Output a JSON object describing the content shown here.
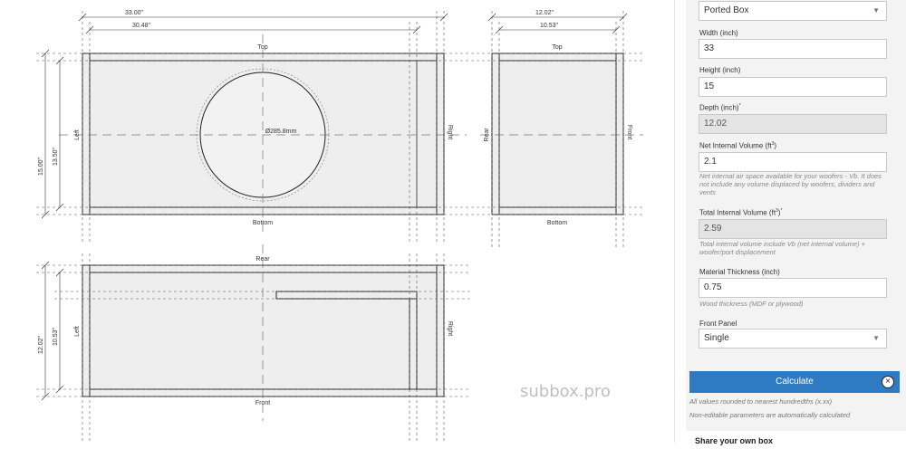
{
  "drawing": {
    "front_view": {
      "width_outer": "33.00\"",
      "width_inner": "30.48\"",
      "top": "Top",
      "bottom": "Bottom",
      "left": "Left",
      "right": "Right",
      "height_outer": "15.00\"",
      "height_inner": "13.50\"",
      "cutout": "Ø285.8mm"
    },
    "side_view": {
      "depth_outer": "12.02\"",
      "depth_inner": "10.53\"",
      "top": "Top",
      "bottom": "Bottom",
      "rear": "Rear",
      "front": "Front"
    },
    "top_view": {
      "rear": "Rear",
      "front": "Front",
      "left": "Left",
      "right": "Right",
      "depth_outer": "12.02\"",
      "depth_inner": "10.53\""
    },
    "watermark": "subbox.pro"
  },
  "panel": {
    "box_type": {
      "value": "Ported Box"
    },
    "width": {
      "label": "Width (inch)",
      "value": "33"
    },
    "height": {
      "label": "Height (inch)",
      "value": "15"
    },
    "depth": {
      "label": "Depth (inch)",
      "sup": "*",
      "value": "12.02"
    },
    "net_volume": {
      "label": "Net Internal Volume (ft",
      "sup": "3",
      "label_end": ")",
      "value": "2.1",
      "help": "Net internal air space available for your woofers - Vb. It does not include any volume displaced by woofers, dividers and vents"
    },
    "total_volume": {
      "label": "Total Internal Volume (ft",
      "sup": "3",
      "label_end": ")",
      "sup2": "*",
      "value": "2.59",
      "help": "Total internal volume include Vb (net internal volume) + woofer/port displacement"
    },
    "thickness": {
      "label": "Material Thickness (inch)",
      "value": "0.75",
      "help": "Wood thickness (MDF or plywood)"
    },
    "front_panel": {
      "label": "Front Panel",
      "value": "Single"
    },
    "calculate_label": "Calculate",
    "close_glyph": "×",
    "note1": "All values rounded to nearest hundredths (x.xx)",
    "note2": "Non-editable parameters are automatically calculated",
    "share_title": "Share your own box"
  },
  "icons": {
    "dropdown": "chevron-down-icon",
    "close": "close-circle-icon"
  }
}
